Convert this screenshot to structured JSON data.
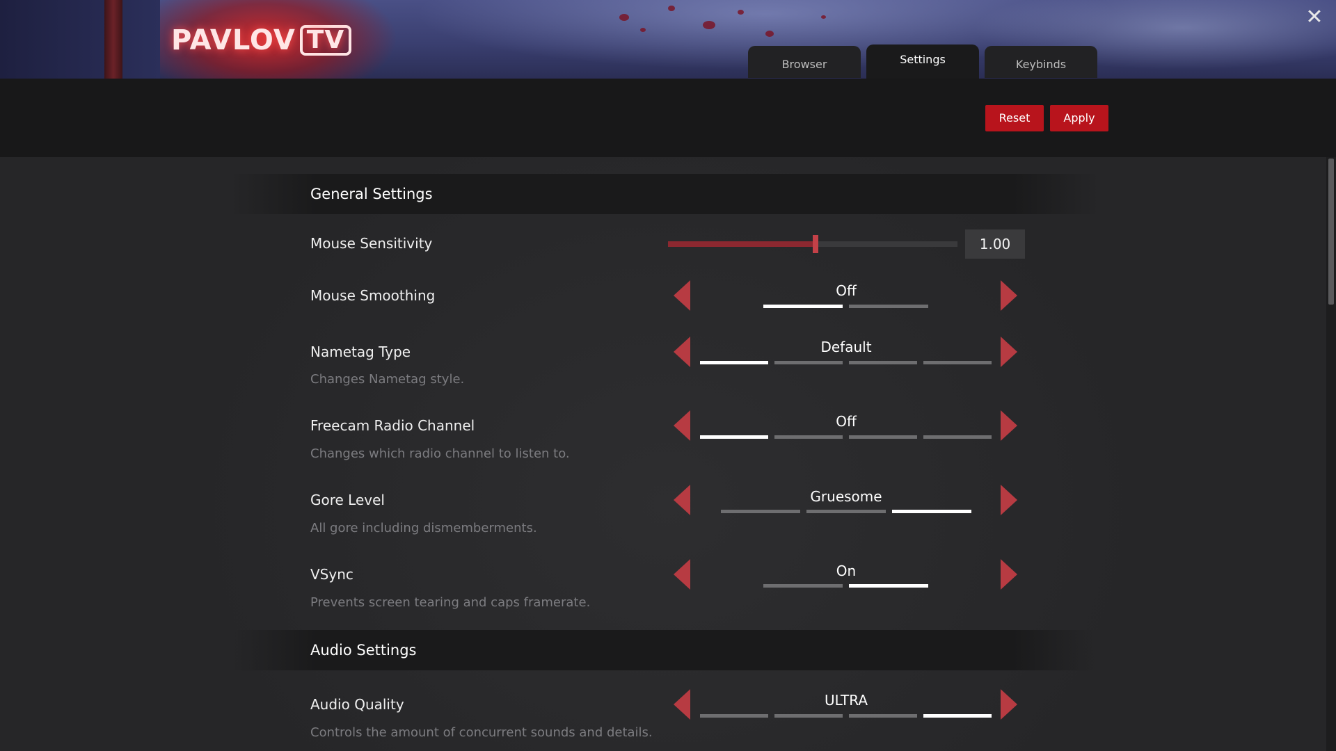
{
  "header": {
    "logo_main": "PAVLOV",
    "logo_tv": "TV",
    "close_icon": "close-icon"
  },
  "tabs": [
    {
      "label": "Browser",
      "active": false
    },
    {
      "label": "Settings",
      "active": true
    },
    {
      "label": "Keybinds",
      "active": false
    }
  ],
  "toolbar": {
    "reset_label": "Reset",
    "apply_label": "Apply",
    "accent_color": "#b8141c"
  },
  "sections": {
    "general": {
      "title": "General Settings",
      "mouse_sensitivity": {
        "label": "Mouse Sensitivity",
        "value": "1.00",
        "slider_fraction": 0.51
      },
      "mouse_smoothing": {
        "label": "Mouse Smoothing",
        "value": "Off",
        "option_count": 2,
        "selected_index": 0
      },
      "nametag_type": {
        "label": "Nametag Type",
        "desc": "Changes Nametag style.",
        "value": "Default",
        "option_count": 4,
        "selected_index": 0
      },
      "freecam_radio": {
        "label": "Freecam Radio Channel",
        "desc": "Changes which radio channel to listen to.",
        "value": "Off",
        "option_count": 4,
        "selected_index": 0
      },
      "gore_level": {
        "label": "Gore Level",
        "desc": "All gore including dismemberments.",
        "value": "Gruesome",
        "option_count": 3,
        "selected_index": 2
      },
      "vsync": {
        "label": "VSync",
        "desc": "Prevents screen tearing and caps framerate.",
        "value": "On",
        "option_count": 2,
        "selected_index": 1
      }
    },
    "audio": {
      "title": "Audio Settings",
      "audio_quality": {
        "label": "Audio Quality",
        "desc": "Controls the amount of concurrent sounds and details.",
        "value": "ULTRA",
        "option_count": 4,
        "selected_index": 3
      }
    }
  }
}
